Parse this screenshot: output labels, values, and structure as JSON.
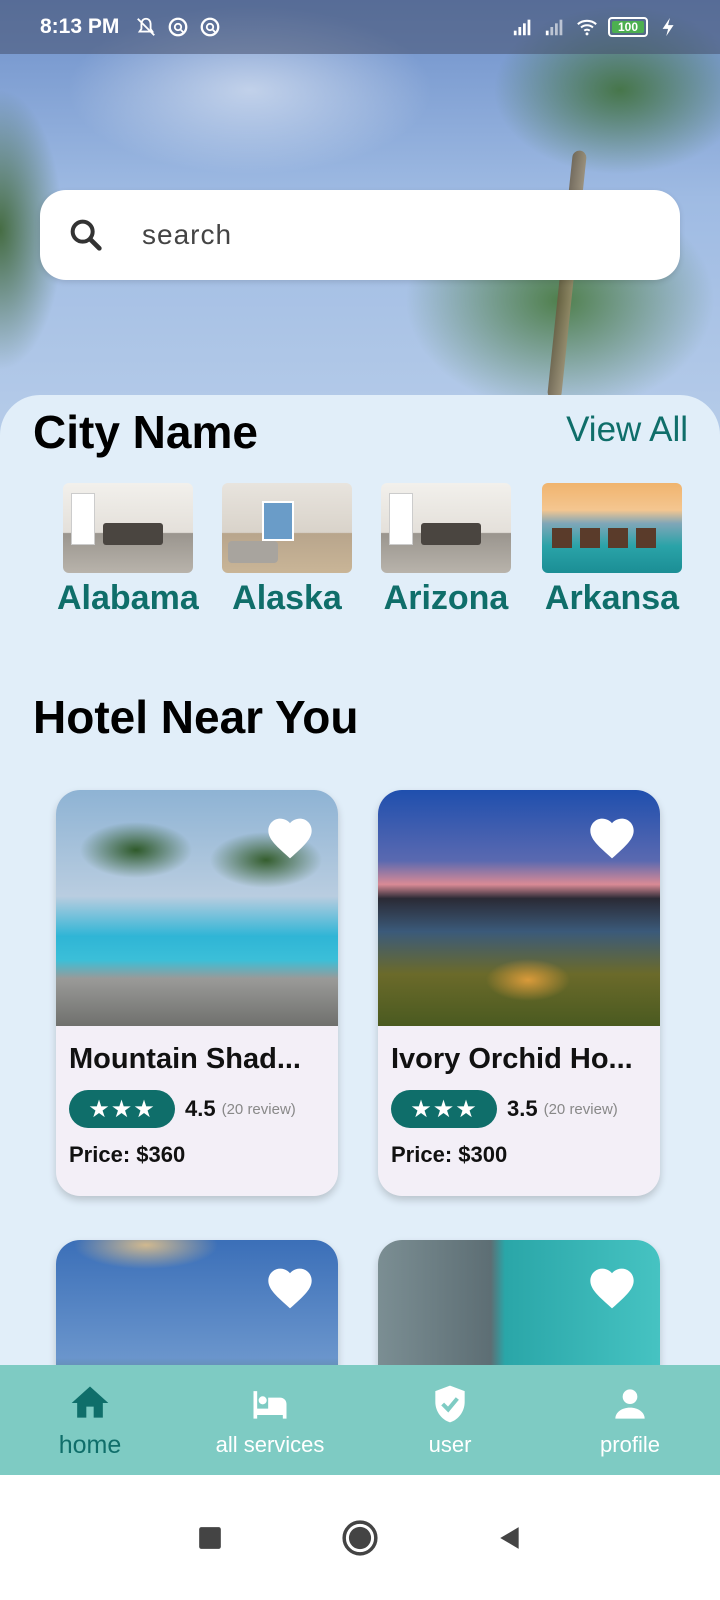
{
  "status_bar": {
    "time": "8:13 PM",
    "battery": "100"
  },
  "search": {
    "placeholder": "search"
  },
  "city_section": {
    "title": "City Name",
    "view_all": "View All",
    "cities": [
      {
        "label": "Alabama"
      },
      {
        "label": "Alaska"
      },
      {
        "label": "Arizona"
      },
      {
        "label": "Arkansa"
      }
    ]
  },
  "hotel_section": {
    "title": "Hotel Near You",
    "hotels": [
      {
        "name": "Mountain Shad...",
        "stars": "★★★",
        "rating": "4.5",
        "reviews": "(20 review)",
        "price": "Price: $360"
      },
      {
        "name": "Ivory Orchid Ho...",
        "stars": "★★★",
        "rating": "3.5",
        "reviews": "(20 review)",
        "price": "Price: $300"
      }
    ]
  },
  "bottom_nav": {
    "items": [
      {
        "label": "home"
      },
      {
        "label": "all services"
      },
      {
        "label": "user"
      },
      {
        "label": "profile"
      }
    ],
    "active": "home"
  },
  "colors": {
    "accent": "#0f6e6a",
    "panel_bg": "#e1eef9",
    "nav_bg": "#7ecbc3",
    "card_bg": "#f3eff7"
  }
}
